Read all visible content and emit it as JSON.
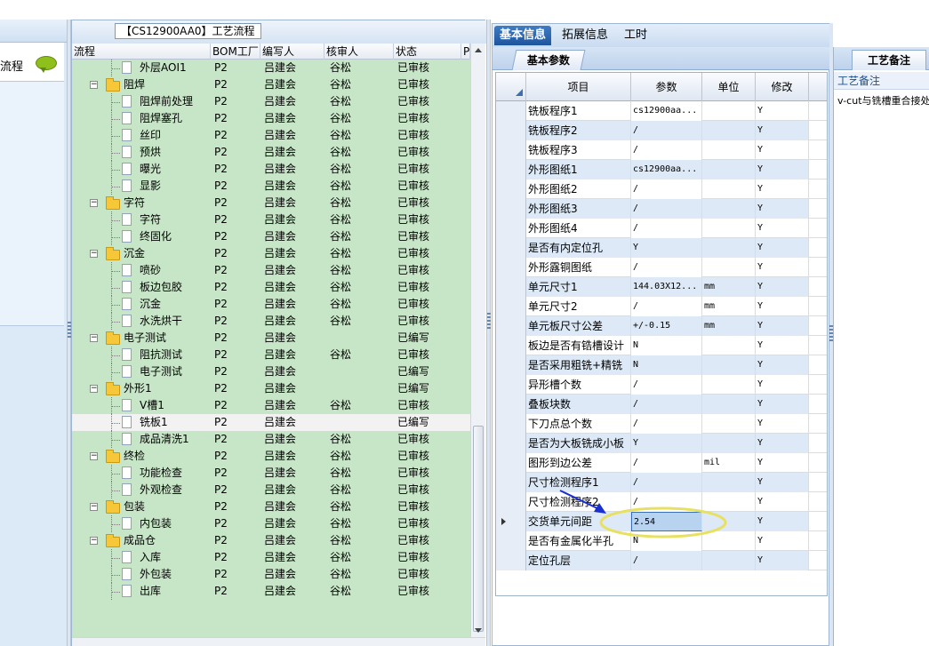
{
  "tree_panel": {
    "title_tab": "【CS12900AA0】工艺流程",
    "columns": [
      "流程",
      "BOM工厂",
      "编写人",
      "核审人",
      "状态",
      "P"
    ],
    "rows": [
      {
        "kind": "leaf",
        "name": "外层AOI1",
        "bom": "P2",
        "writer": "吕建会",
        "checker": "谷松",
        "status": "已审核"
      },
      {
        "kind": "group",
        "name": "阻焊",
        "bom": "P2",
        "writer": "吕建会",
        "checker": "谷松",
        "status": "已审核"
      },
      {
        "kind": "leaf",
        "name": "阻焊前处理",
        "bom": "P2",
        "writer": "吕建会",
        "checker": "谷松",
        "status": "已审核"
      },
      {
        "kind": "leaf",
        "name": "阻焊塞孔",
        "bom": "P2",
        "writer": "吕建会",
        "checker": "谷松",
        "status": "已审核"
      },
      {
        "kind": "leaf",
        "name": "丝印",
        "bom": "P2",
        "writer": "吕建会",
        "checker": "谷松",
        "status": "已审核"
      },
      {
        "kind": "leaf",
        "name": "预烘",
        "bom": "P2",
        "writer": "吕建会",
        "checker": "谷松",
        "status": "已审核"
      },
      {
        "kind": "leaf",
        "name": "曝光",
        "bom": "P2",
        "writer": "吕建会",
        "checker": "谷松",
        "status": "已审核"
      },
      {
        "kind": "leaf",
        "name": "显影",
        "bom": "P2",
        "writer": "吕建会",
        "checker": "谷松",
        "status": "已审核"
      },
      {
        "kind": "group",
        "name": "字符",
        "bom": "P2",
        "writer": "吕建会",
        "checker": "谷松",
        "status": "已审核"
      },
      {
        "kind": "leaf",
        "name": "字符",
        "bom": "P2",
        "writer": "吕建会",
        "checker": "谷松",
        "status": "已审核"
      },
      {
        "kind": "leaf",
        "name": "终固化",
        "bom": "P2",
        "writer": "吕建会",
        "checker": "谷松",
        "status": "已审核"
      },
      {
        "kind": "group",
        "name": "沉金",
        "bom": "P2",
        "writer": "吕建会",
        "checker": "谷松",
        "status": "已审核"
      },
      {
        "kind": "leaf",
        "name": "喷砂",
        "bom": "P2",
        "writer": "吕建会",
        "checker": "谷松",
        "status": "已审核"
      },
      {
        "kind": "leaf",
        "name": "板边包胶",
        "bom": "P2",
        "writer": "吕建会",
        "checker": "谷松",
        "status": "已审核"
      },
      {
        "kind": "leaf",
        "name": "沉金",
        "bom": "P2",
        "writer": "吕建会",
        "checker": "谷松",
        "status": "已审核"
      },
      {
        "kind": "leaf",
        "name": "水洗烘干",
        "bom": "P2",
        "writer": "吕建会",
        "checker": "谷松",
        "status": "已审核"
      },
      {
        "kind": "group",
        "name": "电子测试",
        "bom": "P2",
        "writer": "吕建会",
        "checker": "",
        "status": "已编写"
      },
      {
        "kind": "leaf",
        "name": "阻抗测试",
        "bom": "P2",
        "writer": "吕建会",
        "checker": "谷松",
        "status": "已审核"
      },
      {
        "kind": "leaf",
        "name": "电子测试",
        "bom": "P2",
        "writer": "吕建会",
        "checker": "",
        "status": "已编写"
      },
      {
        "kind": "group",
        "name": "外形1",
        "bom": "P2",
        "writer": "吕建会",
        "checker": "",
        "status": "已编写"
      },
      {
        "kind": "leaf",
        "name": "V槽1",
        "bom": "P2",
        "writer": "吕建会",
        "checker": "谷松",
        "status": "已审核"
      },
      {
        "kind": "leaf",
        "name": "铣板1",
        "bom": "P2",
        "writer": "吕建会",
        "checker": "",
        "status": "已编写",
        "selected": true
      },
      {
        "kind": "leaf",
        "name": "成品清洗1",
        "bom": "P2",
        "writer": "吕建会",
        "checker": "谷松",
        "status": "已审核"
      },
      {
        "kind": "group",
        "name": "终检",
        "bom": "P2",
        "writer": "吕建会",
        "checker": "谷松",
        "status": "已审核"
      },
      {
        "kind": "leaf",
        "name": "功能检查",
        "bom": "P2",
        "writer": "吕建会",
        "checker": "谷松",
        "status": "已审核"
      },
      {
        "kind": "leaf",
        "name": "外观检查",
        "bom": "P2",
        "writer": "吕建会",
        "checker": "谷松",
        "status": "已审核"
      },
      {
        "kind": "group",
        "name": "包装",
        "bom": "P2",
        "writer": "吕建会",
        "checker": "谷松",
        "status": "已审核"
      },
      {
        "kind": "leaf",
        "name": "内包装",
        "bom": "P2",
        "writer": "吕建会",
        "checker": "谷松",
        "status": "已审核"
      },
      {
        "kind": "group",
        "name": "成品仓",
        "bom": "P2",
        "writer": "吕建会",
        "checker": "谷松",
        "status": "已审核"
      },
      {
        "kind": "leaf",
        "name": "入库",
        "bom": "P2",
        "writer": "吕建会",
        "checker": "谷松",
        "status": "已审核"
      },
      {
        "kind": "leaf",
        "name": "外包装",
        "bom": "P2",
        "writer": "吕建会",
        "checker": "谷松",
        "status": "已审核"
      },
      {
        "kind": "leaf",
        "name": "出库",
        "bom": "P2",
        "writer": "吕建会",
        "checker": "谷松",
        "status": "已审核"
      }
    ]
  },
  "left_panel": {
    "item_label": "流程"
  },
  "main_tabs": [
    "基本信息",
    "拓展信息",
    "工时"
  ],
  "sub_tab": "基本参数",
  "grid": {
    "columns": [
      "项目",
      "参数",
      "单位",
      "修改"
    ],
    "rows": [
      {
        "item": "铣板程序1",
        "value": "cs12900aa...",
        "unit": "",
        "mod": "Y"
      },
      {
        "item": "铣板程序2",
        "value": "/",
        "unit": "",
        "mod": "Y"
      },
      {
        "item": "铣板程序3",
        "value": "/",
        "unit": "",
        "mod": "Y"
      },
      {
        "item": "外形图纸1",
        "value": "cs12900aa...",
        "unit": "",
        "mod": "Y"
      },
      {
        "item": "外形图纸2",
        "value": "/",
        "unit": "",
        "mod": "Y"
      },
      {
        "item": "外形图纸3",
        "value": "/",
        "unit": "",
        "mod": "Y"
      },
      {
        "item": "外形图纸4",
        "value": "/",
        "unit": "",
        "mod": "Y"
      },
      {
        "item": "是否有内定位孔",
        "value": "Y",
        "unit": "",
        "mod": "Y"
      },
      {
        "item": "外形露铜图纸",
        "value": "/",
        "unit": "",
        "mod": "Y"
      },
      {
        "item": "单元尺寸1",
        "value": "144.03X12...",
        "unit": "mm",
        "mod": "Y"
      },
      {
        "item": "单元尺寸2",
        "value": "/",
        "unit": "mm",
        "mod": "Y"
      },
      {
        "item": "单元板尺寸公差",
        "value": "+/-0.15",
        "unit": "mm",
        "mod": "Y"
      },
      {
        "item": "板边是否有锆槽设计",
        "value": "N",
        "unit": "",
        "mod": "Y"
      },
      {
        "item": "是否采用粗铣+精铣",
        "value": "N",
        "unit": "",
        "mod": "Y"
      },
      {
        "item": "异形槽个数",
        "value": "/",
        "unit": "",
        "mod": "Y"
      },
      {
        "item": "叠板块数",
        "value": "/",
        "unit": "",
        "mod": "Y"
      },
      {
        "item": "下刀点总个数",
        "value": "/",
        "unit": "",
        "mod": "Y"
      },
      {
        "item": "是否为大板铣成小板",
        "value": "Y",
        "unit": "",
        "mod": "Y"
      },
      {
        "item": "图形到边公差",
        "value": "/",
        "unit": "mil",
        "mod": "Y"
      },
      {
        "item": "尺寸检测程序1",
        "value": "/",
        "unit": "",
        "mod": "Y"
      },
      {
        "item": "尺寸检测程序2",
        "value": "/",
        "unit": "",
        "mod": "Y"
      },
      {
        "item": "交货单元间距",
        "value": "2.54",
        "unit": "",
        "mod": "Y",
        "current": true
      },
      {
        "item": "是否有金属化半孔",
        "value": "N",
        "unit": "",
        "mod": "Y"
      },
      {
        "item": "定位孔层",
        "value": "/",
        "unit": "",
        "mod": "Y"
      }
    ]
  },
  "notes_panel": {
    "tab": "工艺备注",
    "header": "工艺备注",
    "text": "v-cut与铣槽重合接处"
  }
}
